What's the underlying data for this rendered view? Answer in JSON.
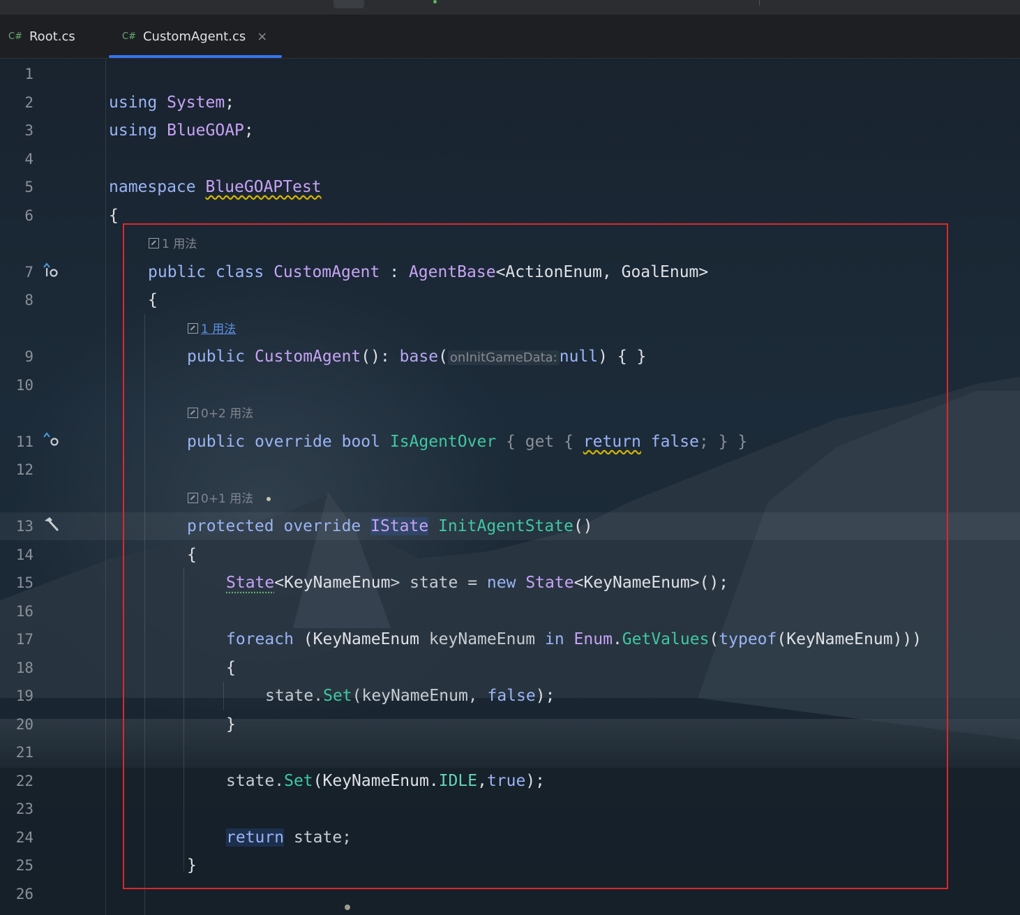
{
  "tabs": [
    {
      "icon": "C#",
      "label": "Root.cs",
      "active": false
    },
    {
      "icon": "C#",
      "label": "CustomAgent.cs",
      "active": true,
      "close": "×"
    }
  ],
  "hints": {
    "h7": "1 用法",
    "h9": "1 用法",
    "h11": "0+2 用法",
    "h13": "0+1 用法"
  },
  "lines": [
    {
      "n": "1"
    },
    {
      "n": "2"
    },
    {
      "n": "3"
    },
    {
      "n": "4"
    },
    {
      "n": "5"
    },
    {
      "n": "6"
    },
    {
      "n": "7"
    },
    {
      "n": "8"
    },
    {
      "n": "9"
    },
    {
      "n": "10"
    },
    {
      "n": "11"
    },
    {
      "n": "12"
    },
    {
      "n": "13"
    },
    {
      "n": "14"
    },
    {
      "n": "15"
    },
    {
      "n": "16"
    },
    {
      "n": "17"
    },
    {
      "n": "18"
    },
    {
      "n": "19"
    },
    {
      "n": "20"
    },
    {
      "n": "21"
    },
    {
      "n": "22"
    },
    {
      "n": "23"
    },
    {
      "n": "24"
    },
    {
      "n": "25"
    },
    {
      "n": "26"
    }
  ],
  "code": {
    "l2": [
      "using",
      " ",
      "System",
      ";"
    ],
    "l3": [
      "using",
      " ",
      "BlueGOAP",
      ";"
    ],
    "l5": [
      "namespace",
      " ",
      "BlueGOAPTest"
    ],
    "l6": "{",
    "l7": [
      "public",
      " ",
      "class",
      " ",
      "CustomAgent",
      " : ",
      "AgentBase",
      "<",
      "ActionEnum",
      ", ",
      "GoalEnum",
      ">"
    ],
    "l8": "{",
    "l9": [
      "public",
      " ",
      "CustomAgent",
      "(): ",
      "base",
      "(",
      "onInitGameData:",
      "null",
      ") { }"
    ],
    "l11": [
      "public",
      " ",
      "override",
      " ",
      "bool",
      " ",
      "IsAgentOver",
      " { ",
      "get",
      " { ",
      "return",
      " ",
      "false",
      "; } }"
    ],
    "l13": [
      "protected",
      " ",
      "override",
      " ",
      "IState",
      " ",
      "InitAgentState",
      "()"
    ],
    "l14": "{",
    "l15": [
      "State",
      "<",
      "KeyNameEnum",
      "> state = ",
      "new",
      " ",
      "State",
      "<",
      "KeyNameEnum",
      ">();"
    ],
    "l17": [
      "foreach",
      " (",
      "KeyNameEnum",
      " keyNameEnum ",
      "in",
      " ",
      "Enum",
      ".",
      "GetValues",
      "(",
      "typeof",
      "(",
      "KeyNameEnum",
      ")))"
    ],
    "l18": "{",
    "l19": [
      "state.",
      "Set",
      "(keyNameEnum, ",
      "false",
      ");"
    ],
    "l20": "}",
    "l22": [
      "state.",
      "Set",
      "(",
      "KeyNameEnum",
      ".",
      "IDLE",
      ",",
      "true",
      ");"
    ],
    "l24": [
      "return",
      " state;"
    ],
    "l25": "}"
  },
  "gutter_icons": {
    "l7": "implemented-override-icon",
    "l11": "override-icon",
    "l13": "hammer-icon"
  }
}
